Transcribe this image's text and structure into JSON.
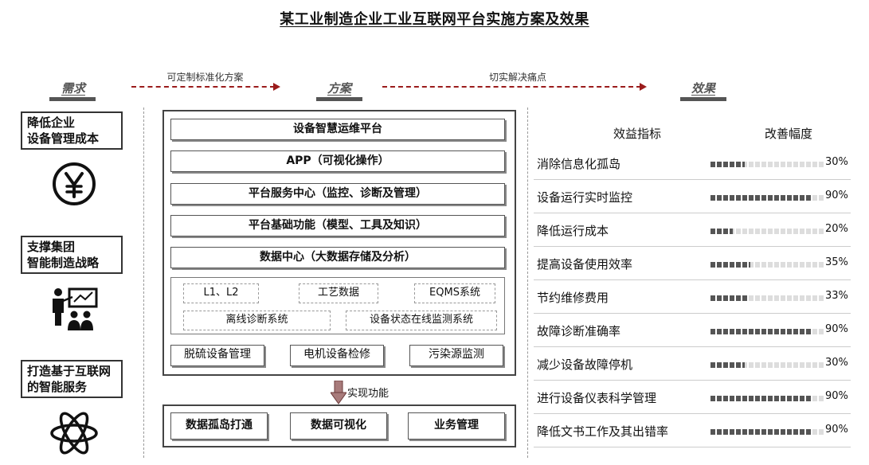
{
  "title": "某工业制造企业工业互联网平台实施方案及效果",
  "headers": {
    "need": "需求",
    "plan": "方案",
    "effect": "效果"
  },
  "arrows": {
    "a1": "可定制标准化方案",
    "a2": "切实解决痛点"
  },
  "needs": [
    {
      "line1": "降低企业",
      "line2": "设备管理成本",
      "icon": "yen-circle-icon"
    },
    {
      "line1": "支撑集团",
      "line2": "智能制造战略",
      "icon": "presenter-audience-icon"
    },
    {
      "line1": "打造基于互联网",
      "line2": "的智能服务",
      "icon": "atom-icon"
    }
  ],
  "layers": [
    "设备智慧运维平台",
    "APP（可视化操作）",
    "平台服务中心（监控、诊断及管理）",
    "平台基础功能（模型、工具及知识）",
    "数据中心（大数据存储及分析）"
  ],
  "systems": {
    "row1": [
      "L1、L2",
      "工艺数据",
      "EQMS系统"
    ],
    "row2": [
      "离线诊断系统",
      "设备状态在线监测系统"
    ]
  },
  "apps": [
    "脱硫设备管理",
    "电机设备检修",
    "污染源监测"
  ],
  "realize": "实现功能",
  "results": [
    "数据孤岛打通",
    "数据可视化",
    "业务管理"
  ],
  "effects_header": {
    "metric": "效益指标",
    "improve": "改善幅度"
  },
  "effects": [
    {
      "label": "消除信息化孤岛",
      "pct": "30%",
      "value": 30
    },
    {
      "label": "设备运行实时监控",
      "pct": "90%",
      "value": 90
    },
    {
      "label": "降低运行成本",
      "pct": "20%",
      "value": 20
    },
    {
      "label": "提高设备使用效率",
      "pct": "35%",
      "value": 35
    },
    {
      "label": "节约维修费用",
      "pct": "33%",
      "value": 33
    },
    {
      "label": "故障诊断准确率",
      "pct": "90%",
      "value": 90
    },
    {
      "label": "减少设备故障停机",
      "pct": "30%",
      "value": 30
    },
    {
      "label": "进行设备仪表科学管理",
      "pct": "90%",
      "value": 90
    },
    {
      "label": "降低文书工作及其出错率",
      "pct": "90%",
      "value": 90
    }
  ]
}
